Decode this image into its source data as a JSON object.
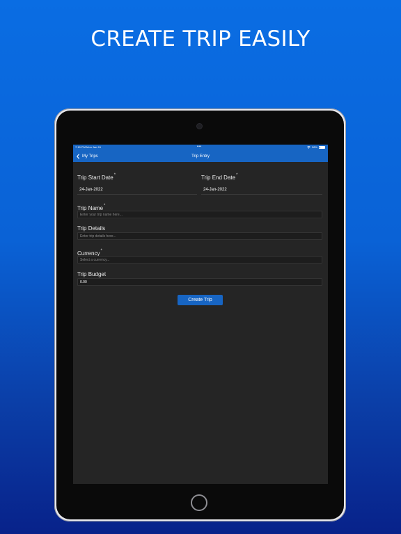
{
  "headline": "CREATE TRIP EASILY",
  "status_bar": {
    "time": "7:15 PM   Mon Jan 24",
    "dots": "•••",
    "battery": "98%"
  },
  "nav": {
    "back_label": "My Trips",
    "title": "Trip Entry"
  },
  "form": {
    "start_date": {
      "label": "Trip Start Date",
      "required": "*",
      "value": "24-Jan-2022"
    },
    "end_date": {
      "label": "Trip End Date",
      "required": "*",
      "value": "24-Jan-2022"
    },
    "trip_name": {
      "label": "Trip Name",
      "required": "*",
      "placeholder": "Enter your trip name here..."
    },
    "trip_details": {
      "label": "Trip Details",
      "placeholder": "Enter trip details here..."
    },
    "currency": {
      "label": "Currency",
      "required": "*",
      "placeholder": "Select a currency..."
    },
    "trip_budget": {
      "label": "Trip Budget",
      "value": "0.00"
    },
    "submit_label": "Create Trip"
  },
  "colors": {
    "accent": "#1765c3",
    "screen_bg": "#252525",
    "page_gradient_top": "#0a6de3",
    "page_gradient_bottom": "#08228a"
  }
}
